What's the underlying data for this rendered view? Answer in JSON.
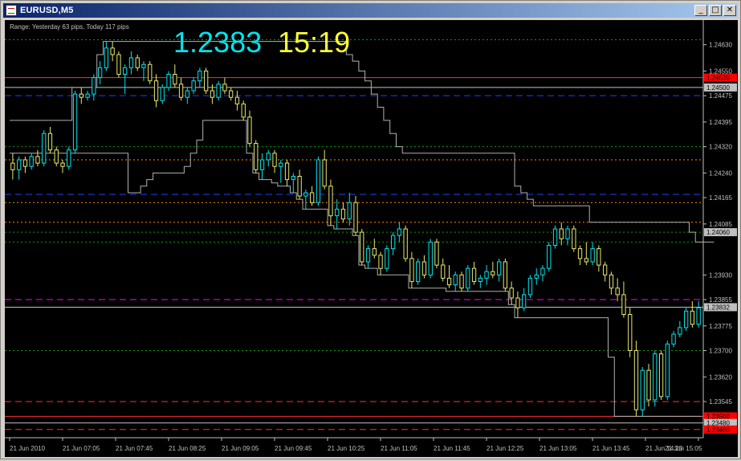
{
  "window": {
    "title": "EURUSD,M5",
    "minimize_glyph": "_",
    "maximize_glyph": "□",
    "close_glyph": "✕"
  },
  "overlay": {
    "range_text": "Range: Yesterday 63 pips, Today 117 pips",
    "big_price": "1.2383",
    "big_time": "15:19",
    "price_color": "#00e5ee",
    "time_color": "#ffff33"
  },
  "chart_data": {
    "type": "candlestick",
    "symbol": "EURUSD",
    "timeframe": "M5",
    "ylim": [
      1.2344,
      1.247
    ],
    "y_ticks": [
      "1.24630",
      "1.24550",
      "1.24475",
      "1.24395",
      "1.24320",
      "1.24240",
      "1.24165",
      "1.24085",
      "1.23930",
      "1.23855",
      "1.23775",
      "1.23700",
      "1.23620",
      "1.23545"
    ],
    "x_tick_labels": [
      "21 Jun 2010",
      "21 Jun 07:05",
      "21 Jun 07:45",
      "21 Jun 08:25",
      "21 Jun 09:05",
      "21 Jun 09:45",
      "21 Jun 10:25",
      "21 Jun 11:05",
      "21 Jun 11:45",
      "21 Jun 12:25",
      "21 Jun 13:05",
      "21 Jun 13:45",
      "21 Jun 14:25",
      "21 Jun 15:05"
    ],
    "price_labels": [
      {
        "text": "1.24530",
        "value": 1.2453,
        "color": "#ff0000"
      },
      {
        "text": "1.24500",
        "value": 1.245,
        "color": "#c0c0c0"
      },
      {
        "text": "1.24060",
        "value": 1.2406,
        "color": "#c0c0c0"
      },
      {
        "text": "1.23832",
        "value": 1.23832,
        "color": "#c0c0c0"
      },
      {
        "text": "1.23500",
        "value": 1.235,
        "color": "#ff0000"
      },
      {
        "text": "1.23480",
        "value": 1.2348,
        "color": "#c0c0c0"
      },
      {
        "text": "1.23460",
        "value": 1.2346,
        "color": "#ff0000"
      }
    ],
    "levels": [
      {
        "value": 1.24645,
        "color": "#00a000",
        "style": "dot"
      },
      {
        "value": 1.2453,
        "color": "#ff3030",
        "style": "solid"
      },
      {
        "value": 1.245,
        "color": "#c0c0c0",
        "style": "solid"
      },
      {
        "value": 1.24475,
        "color": "#2040ff",
        "style": "dash"
      },
      {
        "value": 1.2432,
        "color": "#00a000",
        "style": "dot"
      },
      {
        "value": 1.2428,
        "color": "#ff8c00",
        "style": "dot"
      },
      {
        "value": 1.24175,
        "color": "#2040ff",
        "style": "dash"
      },
      {
        "value": 1.2415,
        "color": "#ff8c00",
        "style": "dot"
      },
      {
        "value": 1.2409,
        "color": "#ff8c00",
        "style": "dot"
      },
      {
        "value": 1.2406,
        "color": "#00a000",
        "style": "dot"
      },
      {
        "value": 1.2403,
        "color": "#00a000",
        "style": "dot"
      },
      {
        "value": 1.23855,
        "color": "#ff00ff",
        "style": "dash"
      },
      {
        "value": 1.23832,
        "color": "#c0c0c0",
        "style": "solid"
      },
      {
        "value": 1.237,
        "color": "#00a000",
        "style": "dot"
      },
      {
        "value": 1.23545,
        "color": "#ff3030",
        "style": "dash"
      },
      {
        "value": 1.235,
        "color": "#ff3030",
        "style": "solid"
      },
      {
        "value": 1.2348,
        "color": "#c0c0c0",
        "style": "solid"
      },
      {
        "value": 1.2346,
        "color": "#ff3030",
        "style": "dash"
      }
    ],
    "candles": [
      {
        "o": 1.2427,
        "h": 1.243,
        "l": 1.2422,
        "c": 1.2425
      },
      {
        "o": 1.2425,
        "h": 1.2429,
        "l": 1.2422,
        "c": 1.2428
      },
      {
        "o": 1.2428,
        "h": 1.2429,
        "l": 1.2424,
        "c": 1.2426
      },
      {
        "o": 1.2426,
        "h": 1.243,
        "l": 1.2425,
        "c": 1.2429
      },
      {
        "o": 1.2429,
        "h": 1.2431,
        "l": 1.2426,
        "c": 1.2427
      },
      {
        "o": 1.2427,
        "h": 1.2437,
        "l": 1.2426,
        "c": 1.2436
      },
      {
        "o": 1.2436,
        "h": 1.2438,
        "l": 1.243,
        "c": 1.2431
      },
      {
        "o": 1.2431,
        "h": 1.2432,
        "l": 1.2426,
        "c": 1.2427
      },
      {
        "o": 1.2427,
        "h": 1.2428,
        "l": 1.2424,
        "c": 1.2426
      },
      {
        "o": 1.2426,
        "h": 1.2432,
        "l": 1.2425,
        "c": 1.2431
      },
      {
        "o": 1.2431,
        "h": 1.2449,
        "l": 1.243,
        "c": 1.2448
      },
      {
        "o": 1.2448,
        "h": 1.245,
        "l": 1.2445,
        "c": 1.2447
      },
      {
        "o": 1.2447,
        "h": 1.2449,
        "l": 1.2446,
        "c": 1.2448
      },
      {
        "o": 1.2448,
        "h": 1.2454,
        "l": 1.2446,
        "c": 1.2453
      },
      {
        "o": 1.2453,
        "h": 1.2458,
        "l": 1.2451,
        "c": 1.2456
      },
      {
        "o": 1.2456,
        "h": 1.2464,
        "l": 1.2455,
        "c": 1.2462
      },
      {
        "o": 1.2462,
        "h": 1.2464,
        "l": 1.2458,
        "c": 1.246
      },
      {
        "o": 1.246,
        "h": 1.2461,
        "l": 1.2453,
        "c": 1.2454
      },
      {
        "o": 1.2454,
        "h": 1.2457,
        "l": 1.2448,
        "c": 1.2456
      },
      {
        "o": 1.2456,
        "h": 1.2461,
        "l": 1.2454,
        "c": 1.2459
      },
      {
        "o": 1.2459,
        "h": 1.246,
        "l": 1.2455,
        "c": 1.2456
      },
      {
        "o": 1.2456,
        "h": 1.2458,
        "l": 1.2452,
        "c": 1.2457
      },
      {
        "o": 1.2457,
        "h": 1.2458,
        "l": 1.2451,
        "c": 1.2452
      },
      {
        "o": 1.2452,
        "h": 1.2454,
        "l": 1.2444,
        "c": 1.2446
      },
      {
        "o": 1.2446,
        "h": 1.2451,
        "l": 1.2445,
        "c": 1.245
      },
      {
        "o": 1.245,
        "h": 1.2455,
        "l": 1.2449,
        "c": 1.2454
      },
      {
        "o": 1.2454,
        "h": 1.2457,
        "l": 1.245,
        "c": 1.2451
      },
      {
        "o": 1.2451,
        "h": 1.2453,
        "l": 1.2446,
        "c": 1.2447
      },
      {
        "o": 1.2447,
        "h": 1.245,
        "l": 1.2445,
        "c": 1.2449
      },
      {
        "o": 1.2449,
        "h": 1.2453,
        "l": 1.2448,
        "c": 1.2452
      },
      {
        "o": 1.2452,
        "h": 1.2456,
        "l": 1.245,
        "c": 1.2455
      },
      {
        "o": 1.2455,
        "h": 1.2456,
        "l": 1.2448,
        "c": 1.2449
      },
      {
        "o": 1.2449,
        "h": 1.2451,
        "l": 1.2445,
        "c": 1.2447
      },
      {
        "o": 1.2447,
        "h": 1.2452,
        "l": 1.2446,
        "c": 1.2451
      },
      {
        "o": 1.2451,
        "h": 1.2453,
        "l": 1.2448,
        "c": 1.2449
      },
      {
        "o": 1.2449,
        "h": 1.245,
        "l": 1.2446,
        "c": 1.2447
      },
      {
        "o": 1.2447,
        "h": 1.2449,
        "l": 1.2443,
        "c": 1.2445
      },
      {
        "o": 1.2445,
        "h": 1.2446,
        "l": 1.244,
        "c": 1.2441
      },
      {
        "o": 1.2441,
        "h": 1.2443,
        "l": 1.2432,
        "c": 1.2433
      },
      {
        "o": 1.2433,
        "h": 1.2434,
        "l": 1.2424,
        "c": 1.2425
      },
      {
        "o": 1.2425,
        "h": 1.243,
        "l": 1.2422,
        "c": 1.2428
      },
      {
        "o": 1.2428,
        "h": 1.2431,
        "l": 1.2426,
        "c": 1.243
      },
      {
        "o": 1.243,
        "h": 1.2431,
        "l": 1.2424,
        "c": 1.2426
      },
      {
        "o": 1.2426,
        "h": 1.2428,
        "l": 1.2421,
        "c": 1.2427
      },
      {
        "o": 1.2427,
        "h": 1.2428,
        "l": 1.242,
        "c": 1.2422
      },
      {
        "o": 1.2422,
        "h": 1.2424,
        "l": 1.2418,
        "c": 1.2423
      },
      {
        "o": 1.2423,
        "h": 1.2425,
        "l": 1.2416,
        "c": 1.2417
      },
      {
        "o": 1.2417,
        "h": 1.2419,
        "l": 1.2413,
        "c": 1.2418
      },
      {
        "o": 1.2418,
        "h": 1.242,
        "l": 1.2414,
        "c": 1.2415
      },
      {
        "o": 1.2415,
        "h": 1.2429,
        "l": 1.2414,
        "c": 1.2428
      },
      {
        "o": 1.2428,
        "h": 1.2431,
        "l": 1.2419,
        "c": 1.242
      },
      {
        "o": 1.242,
        "h": 1.2422,
        "l": 1.2408,
        "c": 1.2411
      },
      {
        "o": 1.2411,
        "h": 1.2416,
        "l": 1.2407,
        "c": 1.2413
      },
      {
        "o": 1.2413,
        "h": 1.2415,
        "l": 1.2409,
        "c": 1.241
      },
      {
        "o": 1.241,
        "h": 1.2418,
        "l": 1.2408,
        "c": 1.2415
      },
      {
        "o": 1.2415,
        "h": 1.2417,
        "l": 1.2405,
        "c": 1.2406
      },
      {
        "o": 1.2406,
        "h": 1.2407,
        "l": 1.2396,
        "c": 1.2397
      },
      {
        "o": 1.2397,
        "h": 1.2402,
        "l": 1.2395,
        "c": 1.2401
      },
      {
        "o": 1.2401,
        "h": 1.2404,
        "l": 1.2398,
        "c": 1.2399
      },
      {
        "o": 1.2399,
        "h": 1.24,
        "l": 1.2393,
        "c": 1.2395
      },
      {
        "o": 1.2395,
        "h": 1.2402,
        "l": 1.2394,
        "c": 1.2401
      },
      {
        "o": 1.2401,
        "h": 1.2406,
        "l": 1.2399,
        "c": 1.2405
      },
      {
        "o": 1.2405,
        "h": 1.2409,
        "l": 1.2403,
        "c": 1.2407
      },
      {
        "o": 1.2407,
        "h": 1.2408,
        "l": 1.2397,
        "c": 1.2398
      },
      {
        "o": 1.2398,
        "h": 1.24,
        "l": 1.2389,
        "c": 1.2391
      },
      {
        "o": 1.2391,
        "h": 1.2398,
        "l": 1.239,
        "c": 1.2397
      },
      {
        "o": 1.2397,
        "h": 1.2399,
        "l": 1.2392,
        "c": 1.2393
      },
      {
        "o": 1.2393,
        "h": 1.2404,
        "l": 1.2392,
        "c": 1.2403
      },
      {
        "o": 1.2403,
        "h": 1.2404,
        "l": 1.2395,
        "c": 1.2396
      },
      {
        "o": 1.2396,
        "h": 1.2398,
        "l": 1.2391,
        "c": 1.2392
      },
      {
        "o": 1.2392,
        "h": 1.2396,
        "l": 1.2389,
        "c": 1.239
      },
      {
        "o": 1.239,
        "h": 1.2394,
        "l": 1.2388,
        "c": 1.2393
      },
      {
        "o": 1.2393,
        "h": 1.2394,
        "l": 1.2388,
        "c": 1.2389
      },
      {
        "o": 1.2389,
        "h": 1.2396,
        "l": 1.2388,
        "c": 1.2395
      },
      {
        "o": 1.2395,
        "h": 1.2397,
        "l": 1.239,
        "c": 1.2391
      },
      {
        "o": 1.2391,
        "h": 1.2393,
        "l": 1.2389,
        "c": 1.2392
      },
      {
        "o": 1.2392,
        "h": 1.2396,
        "l": 1.239,
        "c": 1.2394
      },
      {
        "o": 1.2394,
        "h": 1.2397,
        "l": 1.2392,
        "c": 1.2393
      },
      {
        "o": 1.2393,
        "h": 1.2398,
        "l": 1.2391,
        "c": 1.2397
      },
      {
        "o": 1.2397,
        "h": 1.2398,
        "l": 1.2388,
        "c": 1.2389
      },
      {
        "o": 1.2389,
        "h": 1.2391,
        "l": 1.2384,
        "c": 1.2386
      },
      {
        "o": 1.2386,
        "h": 1.2388,
        "l": 1.238,
        "c": 1.2383
      },
      {
        "o": 1.2383,
        "h": 1.2389,
        "l": 1.2382,
        "c": 1.2387
      },
      {
        "o": 1.2387,
        "h": 1.2393,
        "l": 1.2386,
        "c": 1.2392
      },
      {
        "o": 1.2392,
        "h": 1.2395,
        "l": 1.239,
        "c": 1.2393
      },
      {
        "o": 1.2393,
        "h": 1.2396,
        "l": 1.2391,
        "c": 1.2395
      },
      {
        "o": 1.2395,
        "h": 1.2403,
        "l": 1.2394,
        "c": 1.2402
      },
      {
        "o": 1.2402,
        "h": 1.2408,
        "l": 1.2401,
        "c": 1.2407
      },
      {
        "o": 1.2407,
        "h": 1.2409,
        "l": 1.2402,
        "c": 1.2404
      },
      {
        "o": 1.2404,
        "h": 1.2408,
        "l": 1.2402,
        "c": 1.2407
      },
      {
        "o": 1.2407,
        "h": 1.2408,
        "l": 1.24,
        "c": 1.2401
      },
      {
        "o": 1.2401,
        "h": 1.2402,
        "l": 1.2396,
        "c": 1.2398
      },
      {
        "o": 1.2398,
        "h": 1.2403,
        "l": 1.2396,
        "c": 1.2397
      },
      {
        "o": 1.2397,
        "h": 1.2403,
        "l": 1.2396,
        "c": 1.2401
      },
      {
        "o": 1.2401,
        "h": 1.2402,
        "l": 1.2394,
        "c": 1.2396
      },
      {
        "o": 1.2396,
        "h": 1.2397,
        "l": 1.2391,
        "c": 1.2393
      },
      {
        "o": 1.2393,
        "h": 1.2394,
        "l": 1.2387,
        "c": 1.2389
      },
      {
        "o": 1.2389,
        "h": 1.2392,
        "l": 1.2385,
        "c": 1.2387
      },
      {
        "o": 1.2387,
        "h": 1.2391,
        "l": 1.238,
        "c": 1.2381
      },
      {
        "o": 1.2381,
        "h": 1.2383,
        "l": 1.2368,
        "c": 1.237
      },
      {
        "o": 1.237,
        "h": 1.2373,
        "l": 1.235,
        "c": 1.2352
      },
      {
        "o": 1.2352,
        "h": 1.2365,
        "l": 1.235,
        "c": 1.2364
      },
      {
        "o": 1.2364,
        "h": 1.2366,
        "l": 1.2353,
        "c": 1.2355
      },
      {
        "o": 1.2355,
        "h": 1.237,
        "l": 1.2353,
        "c": 1.2369
      },
      {
        "o": 1.2369,
        "h": 1.237,
        "l": 1.2355,
        "c": 1.2356
      },
      {
        "o": 1.2356,
        "h": 1.2373,
        "l": 1.2355,
        "c": 1.2372
      },
      {
        "o": 1.2372,
        "h": 1.2376,
        "l": 1.2371,
        "c": 1.2375
      },
      {
        "o": 1.2375,
        "h": 1.2379,
        "l": 1.2374,
        "c": 1.2377
      },
      {
        "o": 1.2377,
        "h": 1.2383,
        "l": 1.2376,
        "c": 1.2382
      },
      {
        "o": 1.2382,
        "h": 1.2385,
        "l": 1.2377,
        "c": 1.2378
      },
      {
        "o": 1.2378,
        "h": 1.2385,
        "l": 1.2377,
        "c": 1.2383
      }
    ],
    "upper_band": [
      1.244,
      1.244,
      1.244,
      1.244,
      1.244,
      1.244,
      1.244,
      1.244,
      1.244,
      1.244,
      1.245,
      1.245,
      1.245,
      1.245,
      1.246,
      1.2464,
      1.2464,
      1.2464,
      1.2464,
      1.2464,
      1.2464,
      1.2464,
      1.2464,
      1.2464,
      1.2464,
      1.2464,
      1.2464,
      1.2464,
      1.2464,
      1.2464,
      1.2464,
      1.2464,
      1.2464,
      1.2464,
      1.2464,
      1.2464,
      1.2464,
      1.2464,
      1.2464,
      1.2464,
      1.2464,
      1.2464,
      1.2464,
      1.2464,
      1.2464,
      1.2464,
      1.2464,
      1.2464,
      1.2464,
      1.2464,
      1.2464,
      1.2464,
      1.2464,
      1.2464,
      1.246,
      1.2458,
      1.2455,
      1.2452,
      1.2448,
      1.2444,
      1.244,
      1.2436,
      1.2432,
      1.243,
      1.243,
      1.243,
      1.243,
      1.243,
      1.243,
      1.243,
      1.243,
      1.243,
      1.243,
      1.243,
      1.243,
      1.243,
      1.243,
      1.243,
      1.243,
      1.243,
      1.243,
      1.242,
      1.2418,
      1.2416,
      1.2414,
      1.2414,
      1.2414,
      1.2414,
      1.2414,
      1.2414,
      1.2414,
      1.2414,
      1.2414,
      1.2409,
      1.2409,
      1.2409,
      1.2409,
      1.2409,
      1.2409,
      1.2409,
      1.2409,
      1.2409,
      1.2409,
      1.2409,
      1.2409,
      1.2409,
      1.2409,
      1.2409,
      1.2409,
      1.2406,
      1.2403,
      1.2403,
      1.2403
    ],
    "lower_band": [
      1.243,
      1.243,
      1.243,
      1.243,
      1.243,
      1.243,
      1.243,
      1.243,
      1.243,
      1.243,
      1.243,
      1.243,
      1.243,
      1.243,
      1.243,
      1.243,
      1.243,
      1.243,
      1.243,
      1.2418,
      1.2418,
      1.242,
      1.2422,
      1.2424,
      1.2424,
      1.2424,
      1.2424,
      1.2424,
      1.2426,
      1.243,
      1.2434,
      1.244,
      1.244,
      1.244,
      1.244,
      1.244,
      1.244,
      1.244,
      1.243,
      1.2424,
      1.2422,
      1.2422,
      1.2421,
      1.242,
      1.242,
      1.2418,
      1.2416,
      1.2413,
      1.2413,
      1.2413,
      1.2413,
      1.2408,
      1.2407,
      1.2407,
      1.2407,
      1.2405,
      1.2396,
      1.2395,
      1.2395,
      1.2393,
      1.2393,
      1.2393,
      1.2393,
      1.2393,
      1.2389,
      1.2389,
      1.2389,
      1.2389,
      1.2389,
      1.2389,
      1.2388,
      1.2388,
      1.2388,
      1.2388,
      1.2388,
      1.2388,
      1.2388,
      1.2388,
      1.2388,
      1.2388,
      1.2384,
      1.238,
      1.238,
      1.238,
      1.238,
      1.238,
      1.238,
      1.238,
      1.238,
      1.238,
      1.238,
      1.238,
      1.238,
      1.238,
      1.238,
      1.238,
      1.2368,
      1.235,
      1.235,
      1.235,
      1.235,
      1.235,
      1.235,
      1.235,
      1.235,
      1.235,
      1.235,
      1.235,
      1.235,
      1.235,
      1.235
    ]
  }
}
